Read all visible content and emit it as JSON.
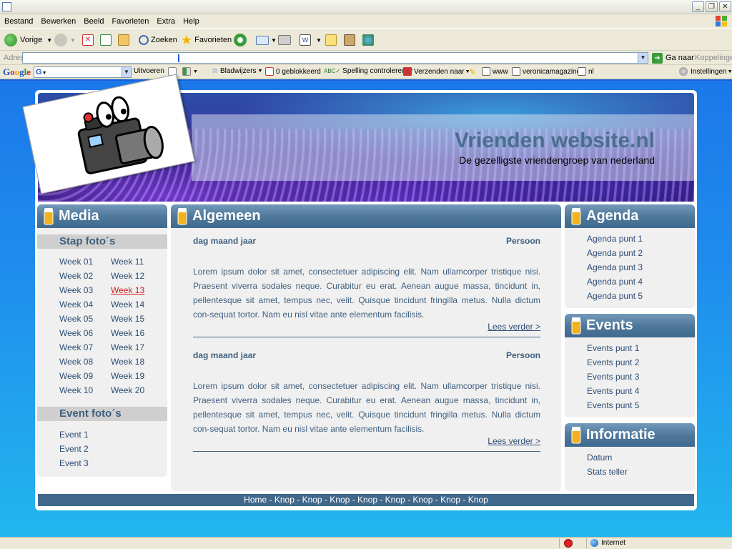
{
  "browser": {
    "menu": [
      "Bestand",
      "Bewerken",
      "Beeld",
      "Favorieten",
      "Extra",
      "Help"
    ],
    "toolbar": {
      "back": "Vorige",
      "search": "Zoeken",
      "favorites": "Favorieten"
    },
    "address": {
      "label": "Adres",
      "value": "",
      "go": "Ga naar",
      "links": "Koppelingen"
    },
    "google_bar": {
      "run": "Uitvoeren",
      "bookmarks": "Bladwijzers",
      "blocked": "0 geblokkeerd",
      "spellcheck": "Spelling controleren",
      "send": "Verzenden naar",
      "links": [
        "www",
        "veronicamagazine",
        "nl"
      ],
      "settings": "Instellingen"
    },
    "status": {
      "zone": "Internet"
    }
  },
  "site": {
    "title": "Vrienden website.nl",
    "tagline": "De gezelligste vriendengroep van nederland",
    "media": {
      "heading": "Media",
      "stap_heading": "Stap foto´s",
      "weeks_left": [
        "Week 01",
        "Week 02",
        "Week 03",
        "Week 04",
        "Week 05",
        "Week 06",
        "Week 07",
        "Week 08",
        "Week 09",
        "Week 10"
      ],
      "weeks_right": [
        "Week 11",
        "Week 12",
        "Week 13",
        "Week 14",
        "Week 15",
        "Week 16",
        "Week 17",
        "Week 18",
        "Week 19",
        "Week 20"
      ],
      "event_heading": "Event foto´s",
      "events": [
        "Event 1",
        "Event 2",
        "Event 3"
      ]
    },
    "main": {
      "heading": "Algemeen",
      "articles": [
        {
          "date": "dag maand jaar",
          "author": "Persoon",
          "body": "Lorem ipsum dolor sit amet, consectetuer adipiscing elit. Nam ullamcorper tristique nisi. Praesent viverra sodales neque. Curabitur eu erat. Aenean augue massa, tincidunt in, pellentesque sit amet, tempus nec, velit. Quisque tincidunt fringilla metus. Nulla dictum con-sequat tortor. Nam eu nisl vitae ante elementum facilisis.",
          "more": "Lees verder >"
        },
        {
          "date": "dag maand jaar",
          "author": "Persoon",
          "body": "Lorem ipsum dolor sit amet, consectetuer adipiscing elit. Nam ullamcorper tristique nisi. Praesent viverra sodales neque. Curabitur eu erat. Aenean augue massa, tincidunt in, pellentesque sit amet, tempus nec, velit. Quisque tincidunt fringilla metus. Nulla dictum con-sequat tortor. Nam eu nisl vitae ante elementum facilisis.",
          "more": "Lees verder >"
        }
      ]
    },
    "agenda": {
      "heading": "Agenda",
      "items": [
        "Agenda punt 1",
        "Agenda punt 2",
        "Agenda punt 3",
        "Agenda punt 4",
        "Agenda punt 5"
      ]
    },
    "events": {
      "heading": "Events",
      "items": [
        "Events punt 1",
        "Events punt 2",
        "Events punt 3",
        "Events punt 4",
        "Events punt 5"
      ]
    },
    "info": {
      "heading": "Informatie",
      "items": [
        "Datum",
        "Stats teller"
      ]
    },
    "footer_nav": [
      "Home",
      "Knop",
      "Knop",
      "Knop",
      "Knop",
      "Knop",
      "Knop",
      "Knop",
      "Knop"
    ],
    "footer_separator": " - "
  },
  "colors": {
    "accent": "#41678b",
    "page_bg": "#1f8ced",
    "active_link": "#d11e1e"
  }
}
